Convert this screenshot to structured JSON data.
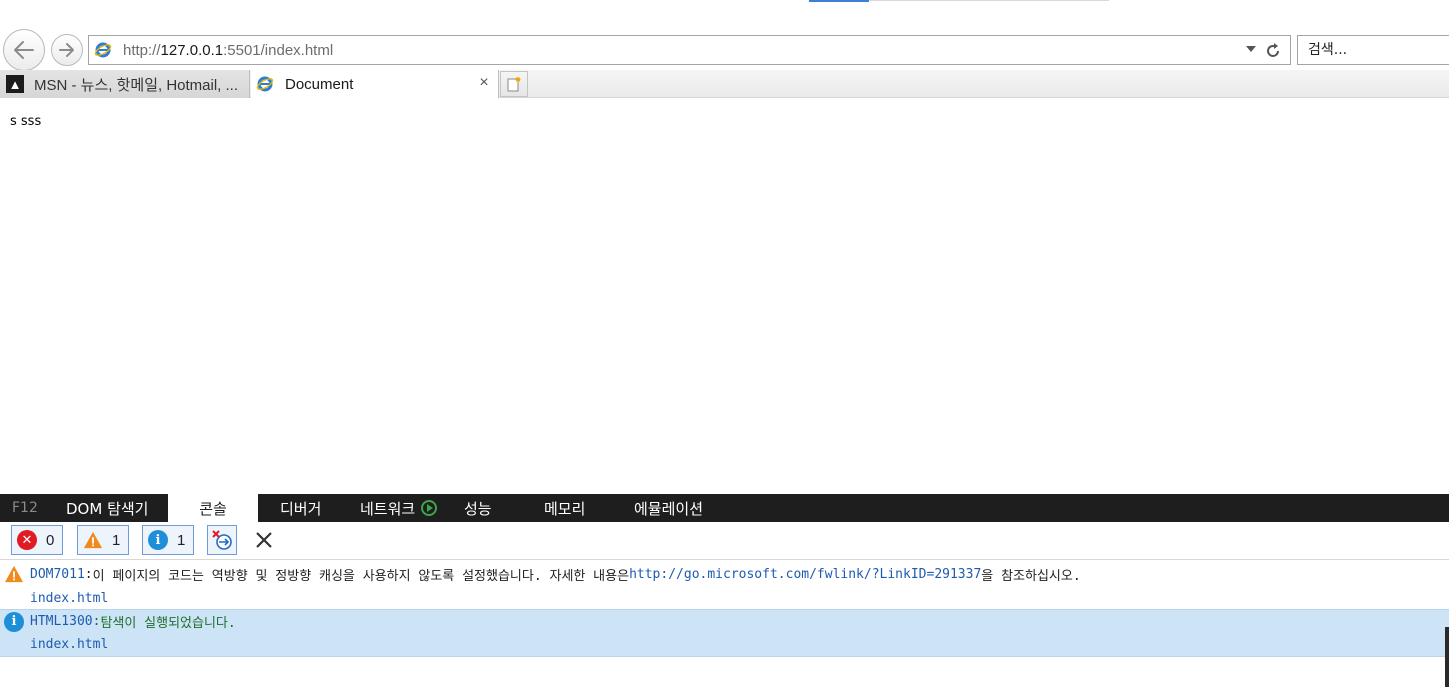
{
  "browser": {
    "address": {
      "prefix": "http://",
      "host": "127.0.0.1",
      "rest": ":5501/index.html"
    },
    "search": {
      "placeholder": "검색..."
    },
    "tabs": [
      {
        "label": "MSN - 뉴스, 핫메일, Hotmail, ...",
        "icon": "msn-icon"
      },
      {
        "label": "Document",
        "icon": "ie-icon",
        "close": "×"
      }
    ]
  },
  "page": {
    "content": "s sss"
  },
  "devtools": {
    "tabs": {
      "f12": "F12",
      "dom": "DOM 탐색기",
      "console": "콘솔",
      "debugger": "디버거",
      "network": "네트워크",
      "performance": "성능",
      "memory": "메모리",
      "emulation": "에뮬레이션"
    },
    "filters": {
      "errors": "0",
      "warnings": "1",
      "info": "1"
    },
    "messages": [
      {
        "level": "warning",
        "code": "DOM7011",
        "sep": ": ",
        "text": "이 페이지의 코드는 역방향 및 정방향 캐싱을 사용하지 않도록 설정했습니다. 자세한 내용은 ",
        "link": "http://go.microsoft.com/fwlink/?LinkID=291337",
        "suffix": "을 참조하십시오.",
        "source": "index.html"
      },
      {
        "level": "info",
        "code": "HTML1300",
        "sep": ": ",
        "text": "탐색이 실행되었습니다.",
        "source": "index.html"
      }
    ]
  },
  "colors": {
    "accent": "#3c7fd6",
    "devtools_bar": "#1e1e1e",
    "error": "#e01b24",
    "warning": "#f08a1c",
    "info": "#1c8fd8",
    "selected_row": "#cce4f6"
  }
}
